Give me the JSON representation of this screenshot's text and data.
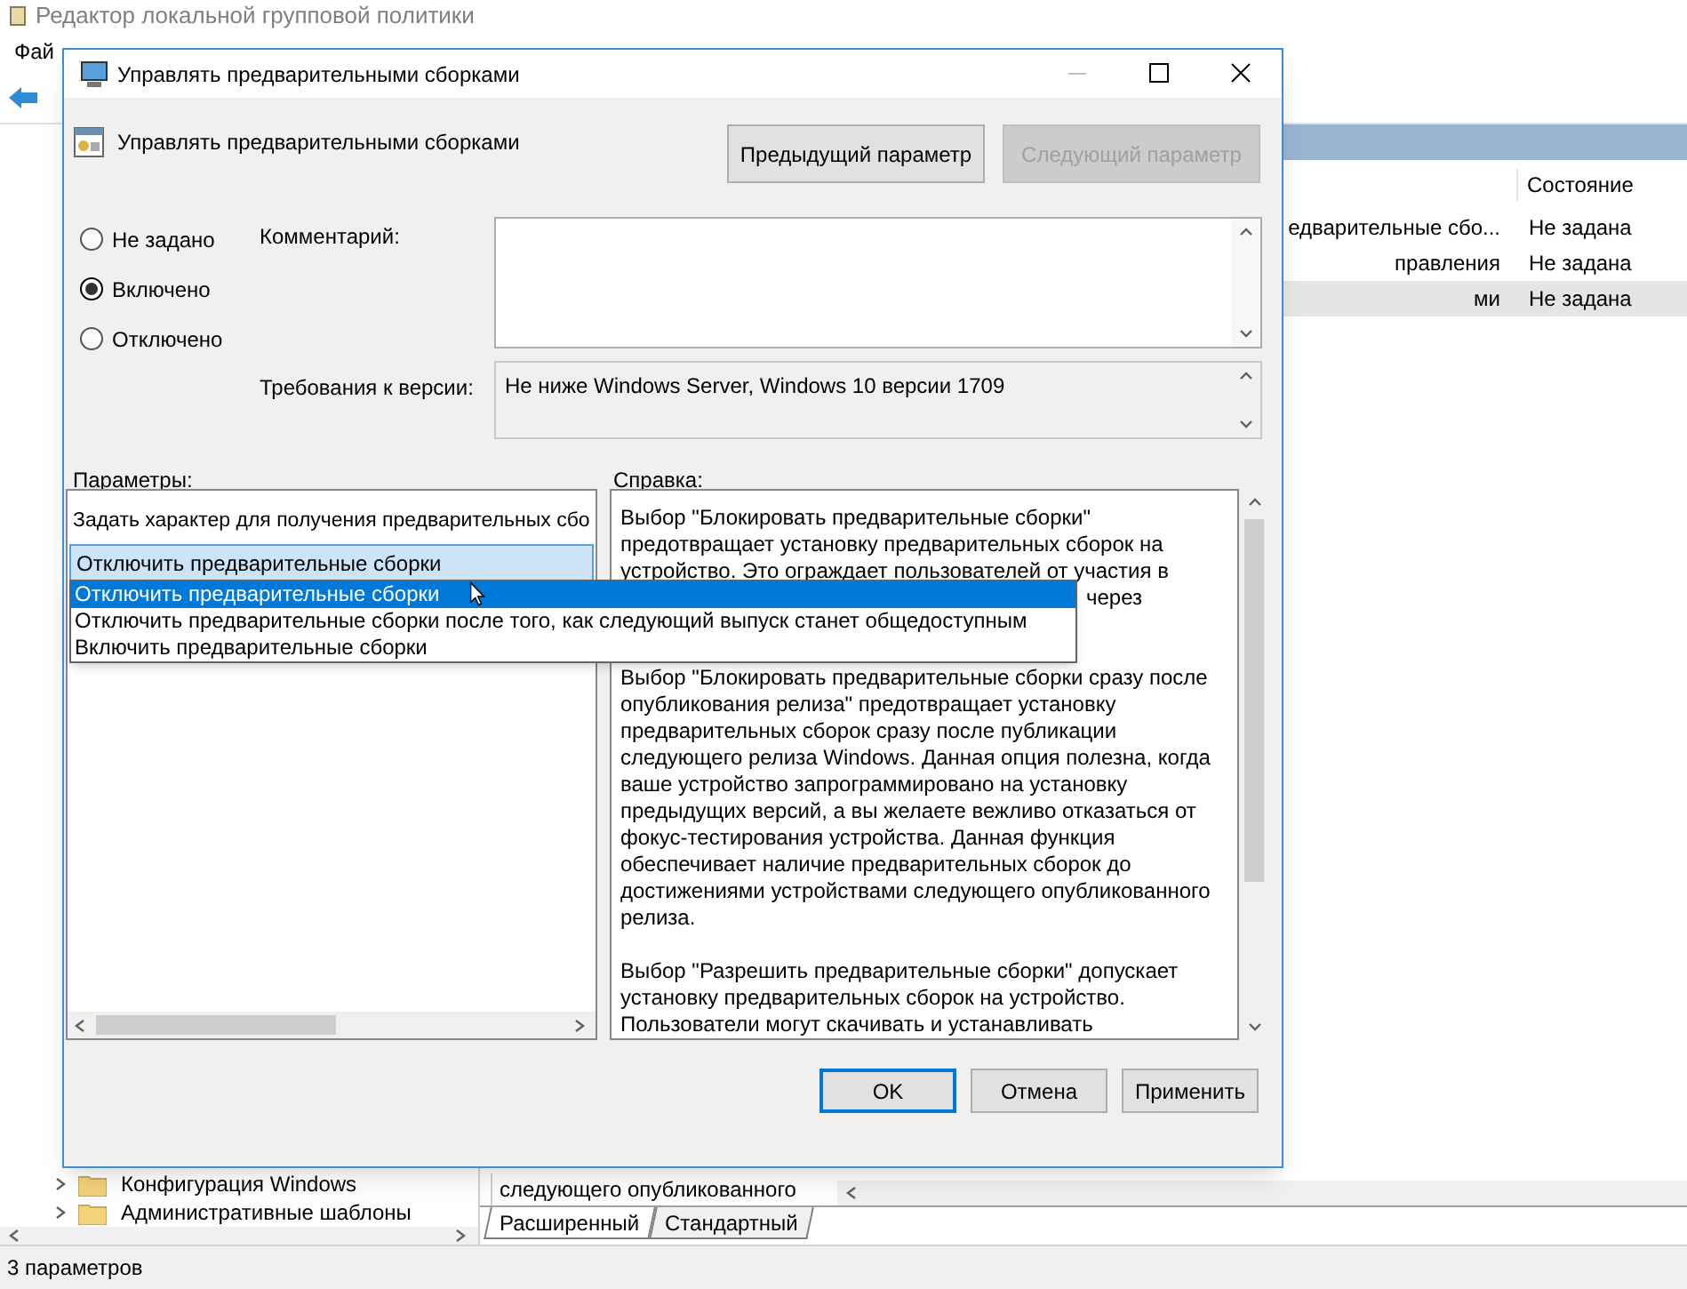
{
  "main_window": {
    "title": "Редактор локальной групповой политики",
    "menu": [
      "Фай"
    ],
    "list": {
      "columns": [
        "Состояние"
      ],
      "rows": [
        {
          "name": "едварительные сбо...",
          "state": "Не задана",
          "selected": false
        },
        {
          "name": "правления",
          "state": "Не задана",
          "selected": false
        },
        {
          "name": "ми",
          "state": "Не задана",
          "selected": true
        }
      ]
    },
    "tree": [
      {
        "label": "Конфигурация Windows"
      },
      {
        "label": "Административные шаблоны"
      }
    ],
    "description_text": "следующего опубликованного",
    "tabs": [
      {
        "label": "Расширенный",
        "selected": true
      },
      {
        "label": "Стандартный",
        "selected": false
      }
    ],
    "status_bar": "3 параметров"
  },
  "dialog": {
    "title": "Управлять предварительными сборками",
    "heading": "Управлять предварительными сборками",
    "nav_buttons": [
      {
        "label": "Предыдущий параметр",
        "disabled": false
      },
      {
        "label": "Следующий параметр",
        "disabled": true
      }
    ],
    "options": [
      {
        "label": "Не задано",
        "selected": false
      },
      {
        "label": "Включено",
        "selected": true
      },
      {
        "label": "Отключено",
        "selected": false
      }
    ],
    "comment_label": "Комментарий:",
    "requirements_label": "Требования к версии:",
    "requirements": "Не ниже Windows Server, Windows 10 версии 1709",
    "parameters_label": "Параметры:",
    "help_label": "Справка:",
    "parameter_prompt": "Задать характер для получения предварительных сбо",
    "combo_value": "Отключить предварительные сборки",
    "dropdown": [
      {
        "label": "Отключить предварительные сборки",
        "selected": true
      },
      {
        "label": "Отключить предварительные сборки после того, как следующий выпуск станет общедоступным",
        "selected": false
      },
      {
        "label": "Включить предварительные сборки",
        "selected": false
      }
    ],
    "help_lines": [
      {
        "text": "Выбор \"Блокировать предварительные сборки\""
      },
      {
        "text": "предотвращает установку предварительных сборок на"
      },
      {
        "text": "устройство. Это ограждает пользователей от участия в"
      },
      {
        "kind": "tail",
        "text": "через"
      },
      {
        "kind": "blank"
      },
      {
        "kind": "blank"
      },
      {
        "text": "Выбор \"Блокировать предварительные сборки сразу после"
      },
      {
        "text": "опубликования релиза\" предотвращает установку"
      },
      {
        "text": "предварительных сборок сразу после публикации"
      },
      {
        "text": "следующего релиза Windows. Данная опция полезна, когда"
      },
      {
        "text": "ваше устройство запрограммировано на установку"
      },
      {
        "text": "предыдущих версий, а вы желаете вежливо отказаться от"
      },
      {
        "text": "фокус-тестирования устройства. Данная функция"
      },
      {
        "text": "обеспечивает наличие предварительных сборок до"
      },
      {
        "text": "достижениями устройствами следующего опубликованного"
      },
      {
        "text": "релиза."
      },
      {
        "kind": "blank"
      },
      {
        "text": "Выбор \"Разрешить предварительные сборки\" допускает"
      },
      {
        "text": "установку предварительных сборок на устройство."
      },
      {
        "text": "Пользователи могут скачивать и устанавливать"
      }
    ],
    "buttons": [
      {
        "label": "OK",
        "default": true
      },
      {
        "label": "Отмена",
        "default": false
      },
      {
        "label": "Применить",
        "default": false
      }
    ]
  }
}
